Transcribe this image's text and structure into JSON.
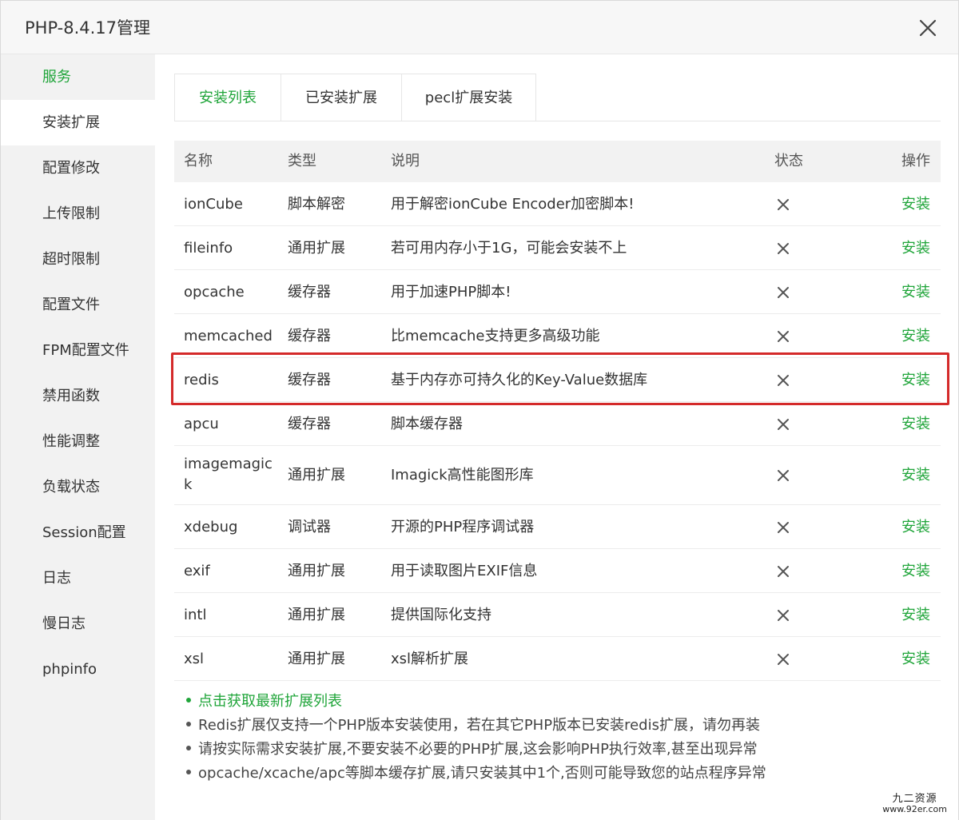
{
  "window": {
    "title": "PHP-8.4.17管理"
  },
  "sidebar": {
    "items": [
      {
        "label": "服务"
      },
      {
        "label": "安装扩展"
      },
      {
        "label": "配置修改"
      },
      {
        "label": "上传限制"
      },
      {
        "label": "超时限制"
      },
      {
        "label": "配置文件"
      },
      {
        "label": "FPM配置文件"
      },
      {
        "label": "禁用函数"
      },
      {
        "label": "性能调整"
      },
      {
        "label": "负载状态"
      },
      {
        "label": "Session配置"
      },
      {
        "label": "日志"
      },
      {
        "label": "慢日志"
      },
      {
        "label": "phpinfo"
      }
    ]
  },
  "tabs": [
    {
      "label": "安装列表"
    },
    {
      "label": "已安装扩展"
    },
    {
      "label": "pecl扩展安装"
    }
  ],
  "table": {
    "headers": {
      "name": "名称",
      "type": "类型",
      "desc": "说明",
      "status": "状态",
      "action": "操作"
    },
    "rows": [
      {
        "name": "ionCube",
        "type": "脚本解密",
        "desc": "用于解密ionCube Encoder加密脚本!",
        "action": "安装"
      },
      {
        "name": "fileinfo",
        "type": "通用扩展",
        "desc": "若可用内存小于1G，可能会安装不上",
        "action": "安装"
      },
      {
        "name": "opcache",
        "type": "缓存器",
        "desc": "用于加速PHP脚本!",
        "action": "安装"
      },
      {
        "name": "memcached",
        "type": "缓存器",
        "desc": "比memcache支持更多高级功能",
        "action": "安装"
      },
      {
        "name": "redis",
        "type": "缓存器",
        "desc": "基于内存亦可持久化的Key-Value数据库",
        "action": "安装"
      },
      {
        "name": "apcu",
        "type": "缓存器",
        "desc": "脚本缓存器",
        "action": "安装"
      },
      {
        "name": "imagemagick",
        "type": "通用扩展",
        "desc": "Imagick高性能图形库",
        "action": "安装"
      },
      {
        "name": "xdebug",
        "type": "调试器",
        "desc": "开源的PHP程序调试器",
        "action": "安装"
      },
      {
        "name": "exif",
        "type": "通用扩展",
        "desc": "用于读取图片EXIF信息",
        "action": "安装"
      },
      {
        "name": "intl",
        "type": "通用扩展",
        "desc": "提供国际化支持",
        "action": "安装"
      },
      {
        "name": "xsl",
        "type": "通用扩展",
        "desc": "xsl解析扩展",
        "action": "安装"
      }
    ]
  },
  "notes": [
    {
      "text": "点击获取最新扩展列表"
    },
    {
      "text": "Redis扩展仅支持一个PHP版本安装使用，若在其它PHP版本已安装redis扩展，请勿再装"
    },
    {
      "text": "请按实际需求安装扩展,不要安装不必要的PHP扩展,这会影响PHP执行效率,甚至出现异常"
    },
    {
      "text": "opcache/xcache/apc等脚本缓存扩展,请只安装其中1个,否则可能导致您的站点程序异常"
    }
  ],
  "watermark": {
    "line1": "九二资源",
    "line2": "www.92er.com"
  },
  "colors": {
    "accent": "#20a53a",
    "highlight": "#d42a2a"
  }
}
